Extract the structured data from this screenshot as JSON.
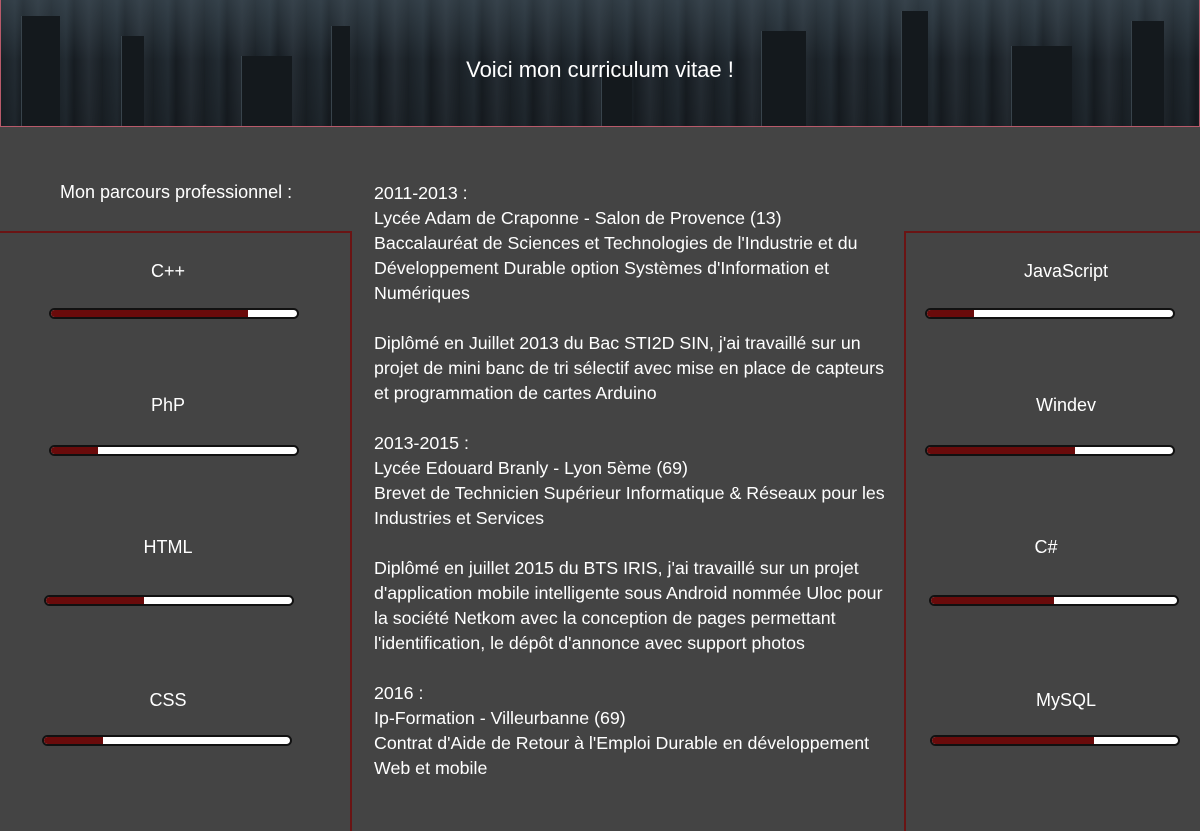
{
  "header": {
    "title": "Voici mon curriculum vitae !"
  },
  "section_title": "Mon parcours professionnel :",
  "skills_left": [
    {
      "name": "C++",
      "level": 0.8
    },
    {
      "name": "PhP",
      "level": 0.19
    },
    {
      "name": "HTML",
      "level": 0.4
    },
    {
      "name": "CSS",
      "level": 0.24
    }
  ],
  "skills_right": [
    {
      "name": "JavaScript",
      "level": 0.19
    },
    {
      "name": "Windev",
      "level": 0.6
    },
    {
      "name": "C#",
      "level": 0.5
    },
    {
      "name": "MySQL",
      "level": 0.66
    }
  ],
  "colors": {
    "background": "#444444",
    "bar_fill": "#6a0b0b",
    "bar_empty": "#ffffff",
    "column_border": "#6a1414"
  },
  "timeline": [
    {
      "period": "2011-2013 :",
      "school": "Lycée Adam de Craponne - Salon de Provence (13)",
      "degree": "Baccalauréat de Sciences et Technologies de l'Industrie et du Développement Durable option Systèmes d'Information et Numériques",
      "description": "Diplômé en Juillet 2013 du Bac STI2D SIN, j'ai travaillé sur un projet de mini banc de tri sélectif avec mise en place de capteurs et programmation de cartes Arduino"
    },
    {
      "period": "2013-2015 :",
      "school": "Lycée Edouard Branly - Lyon 5ème (69)",
      "degree": "Brevet de Technicien Supérieur Informatique & Réseaux pour les Industries et Services",
      "description": "Diplômé en juillet 2015 du BTS IRIS, j'ai travaillé sur un projet d'application mobile intelligente sous Android nommée Uloc pour la société Netkom avec la conception de pages permettant l'identification, le dépôt d'annonce avec support photos"
    },
    {
      "period": "2016 :",
      "school": "Ip-Formation - Villeurbanne (69)",
      "degree": "Contrat d'Aide de Retour à l'Emploi Durable en développement Web et mobile"
    }
  ]
}
